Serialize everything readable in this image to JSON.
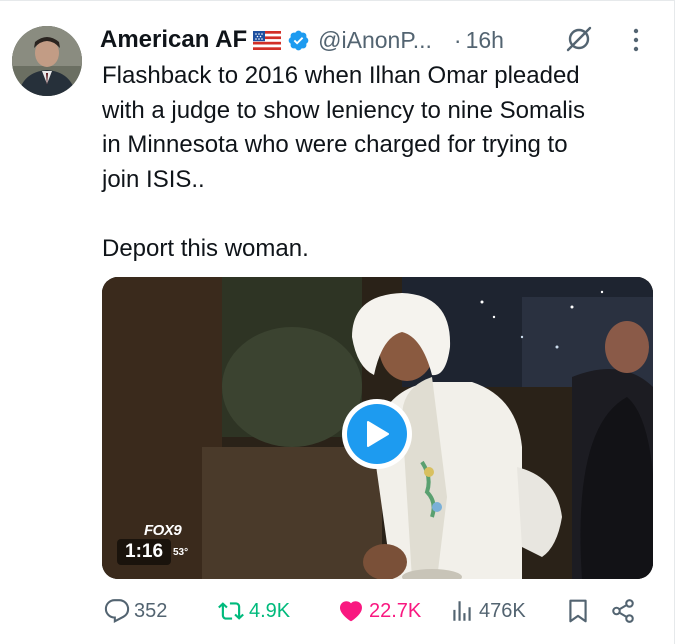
{
  "author": {
    "name": "American AF",
    "handle": "@iAnonP...",
    "separator": "·",
    "time": "16h",
    "flag_icon": "us-flag-icon",
    "verified_icon": "verified-badge-icon"
  },
  "tweet": {
    "text": "Flashback to 2016 when Ilhan Omar pleaded\nwith a judge to show leniency to nine Somalis\nin Minnesota who were charged for trying to\njoin ISIS..\n\nDeport this woman."
  },
  "video": {
    "duration": "1:16",
    "broadcaster": "FOX9",
    "temperature": "53°"
  },
  "actions": {
    "replies": "352",
    "reposts": "4.9K",
    "likes": "22.7K",
    "views": "476K"
  },
  "colors": {
    "accent": "#1d9bf0",
    "repost_active": "#00ba7c",
    "like_active": "#f91880",
    "secondary_text": "#536471"
  }
}
